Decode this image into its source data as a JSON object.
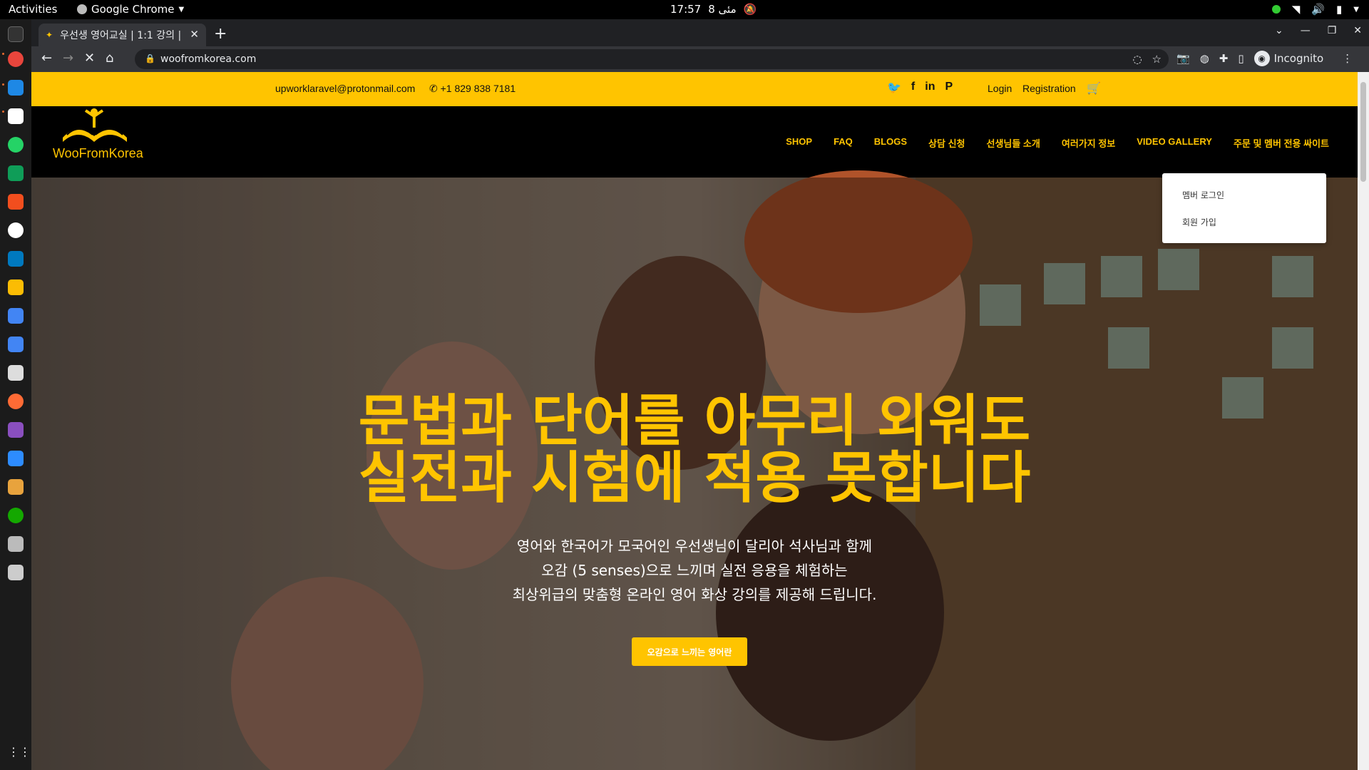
{
  "os": {
    "activities": "Activities",
    "app_name": "Google Chrome",
    "time": "17:57",
    "date": "8 مئی"
  },
  "browser": {
    "tab_title": "우선생 영어교실 | 1:1 강의 |",
    "url": "woofromkorea.com",
    "profile_label": "Incognito"
  },
  "topinfo": {
    "email": "upworklaravel@protonmail.com",
    "phone": "+1 829 838 7181",
    "login": "Login",
    "registration": "Registration"
  },
  "logo": {
    "text": "WooFromKorea"
  },
  "nav": {
    "items": [
      "SHOP",
      "FAQ",
      "BLOGS",
      "상담 신청",
      "선생님들 소개",
      "여러가지 정보",
      "VIDEO GALLERY",
      "주문 및 멤버 전용 싸이트"
    ]
  },
  "dropdown": {
    "items": [
      "멤버 로그인",
      "회원 가입"
    ]
  },
  "hero": {
    "headline_line1": "문법과 단어를 아무리 외워도",
    "headline_line2": "실전과 시험에 적용 못합니다",
    "sub_line1": "영어와 한국어가 모국어인 우선생님이 달리아 석사님과 함께",
    "sub_line2": "오감 (5 senses)으로 느끼며 실전 응용을 체험하는",
    "sub_line3": "최상위급의 맞춤형 온라인 영어 화상 강의를 제공해 드립니다.",
    "cta": "오감으로 느끼는 영어란"
  },
  "colors": {
    "brand_yellow": "#ffc400",
    "nav_bg": "#000000"
  }
}
